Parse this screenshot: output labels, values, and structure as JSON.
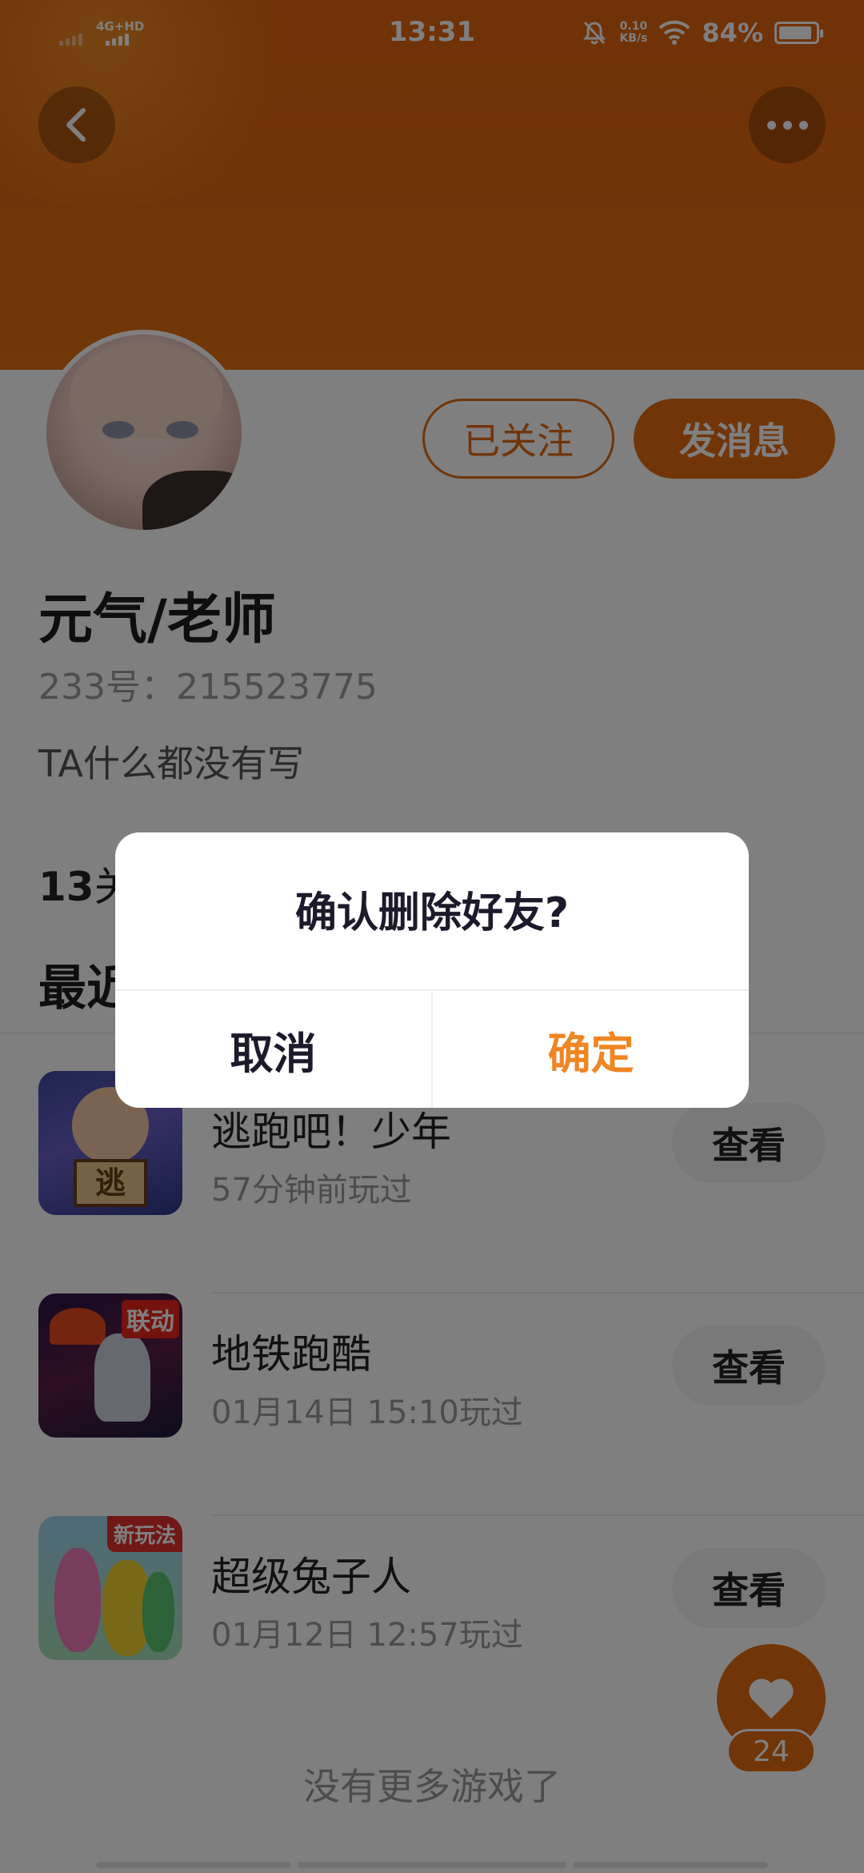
{
  "status_bar": {
    "network": "4G+HD",
    "time": "13:31",
    "speed_value": "0.10",
    "speed_unit": "KB/s",
    "battery": "84%"
  },
  "profile": {
    "follow_label": "已关注",
    "message_label": "发消息",
    "nickname": "元气/老师",
    "uid": "233号：215523775",
    "bio": "TA什么都没有写",
    "stat_number": "13",
    "stat_label": "关",
    "recent_title": "最近"
  },
  "games": [
    {
      "name": "逃跑吧！少年",
      "time": "57分钟前玩过",
      "view_label": "查看",
      "icon_text": "逃"
    },
    {
      "name": "地铁跑酷",
      "time": "01月14日 15:10玩过",
      "view_label": "查看",
      "icon_tag": "联动"
    },
    {
      "name": "超级兔子人",
      "time": "01月12日 12:57玩过",
      "view_label": "查看",
      "icon_tag": "新玩法"
    }
  ],
  "no_more_text": "没有更多游戏了",
  "like_count": "24",
  "dialog": {
    "title": "确认删除好友?",
    "cancel_label": "取消",
    "confirm_label": "确定"
  },
  "colors": {
    "accent": "#e36a10",
    "confirm": "#f08523"
  }
}
